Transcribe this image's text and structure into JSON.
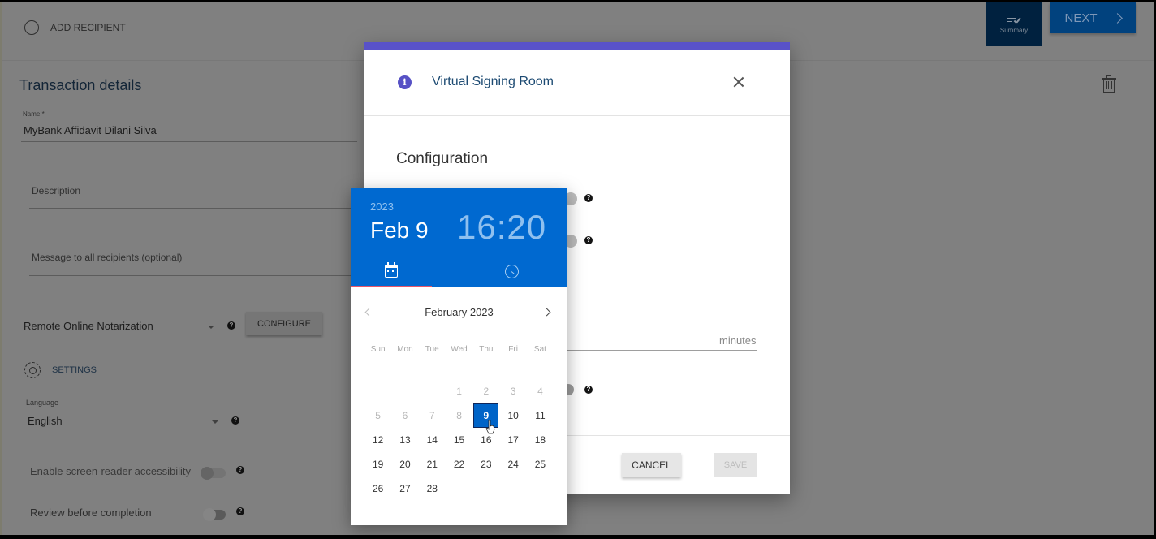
{
  "topbar": {
    "add_recipient_label": "ADD RECIPIENT",
    "summary_label": "Summary",
    "next_label": "NEXT"
  },
  "transaction": {
    "title": "Transaction details",
    "name_label": "Name *",
    "name_value": "MyBank Affidavit Dilani Silva",
    "description_placeholder": "Description",
    "message_placeholder": "Message to all recipients (optional)",
    "notarization_value": "Remote Online Notarization",
    "configure_label": "CONFIGURE",
    "settings_label": "SETTINGS",
    "language_label": "Language",
    "language_value": "English",
    "screen_reader_label": "Enable screen-reader accessibility",
    "review_label": "Review before completion"
  },
  "modal": {
    "title": "Virtual Signing Room",
    "section_title": "Configuration",
    "minutes_suffix": "minutes",
    "cancel_label": "CANCEL",
    "save_label": "SAVE",
    "accent_color": "#5952c9"
  },
  "picker": {
    "year": "2023",
    "date": "Feb 9",
    "time": "16:20",
    "month_label": "February 2023",
    "weekdays": [
      "Sun",
      "Mon",
      "Tue",
      "Wed",
      "Thu",
      "Fri",
      "Sat"
    ],
    "leading_blanks": 3,
    "days_in_month": 28,
    "disabled_through": 8,
    "selected_day": 9,
    "header_color": "#0069d0"
  },
  "help_glyph": "?"
}
